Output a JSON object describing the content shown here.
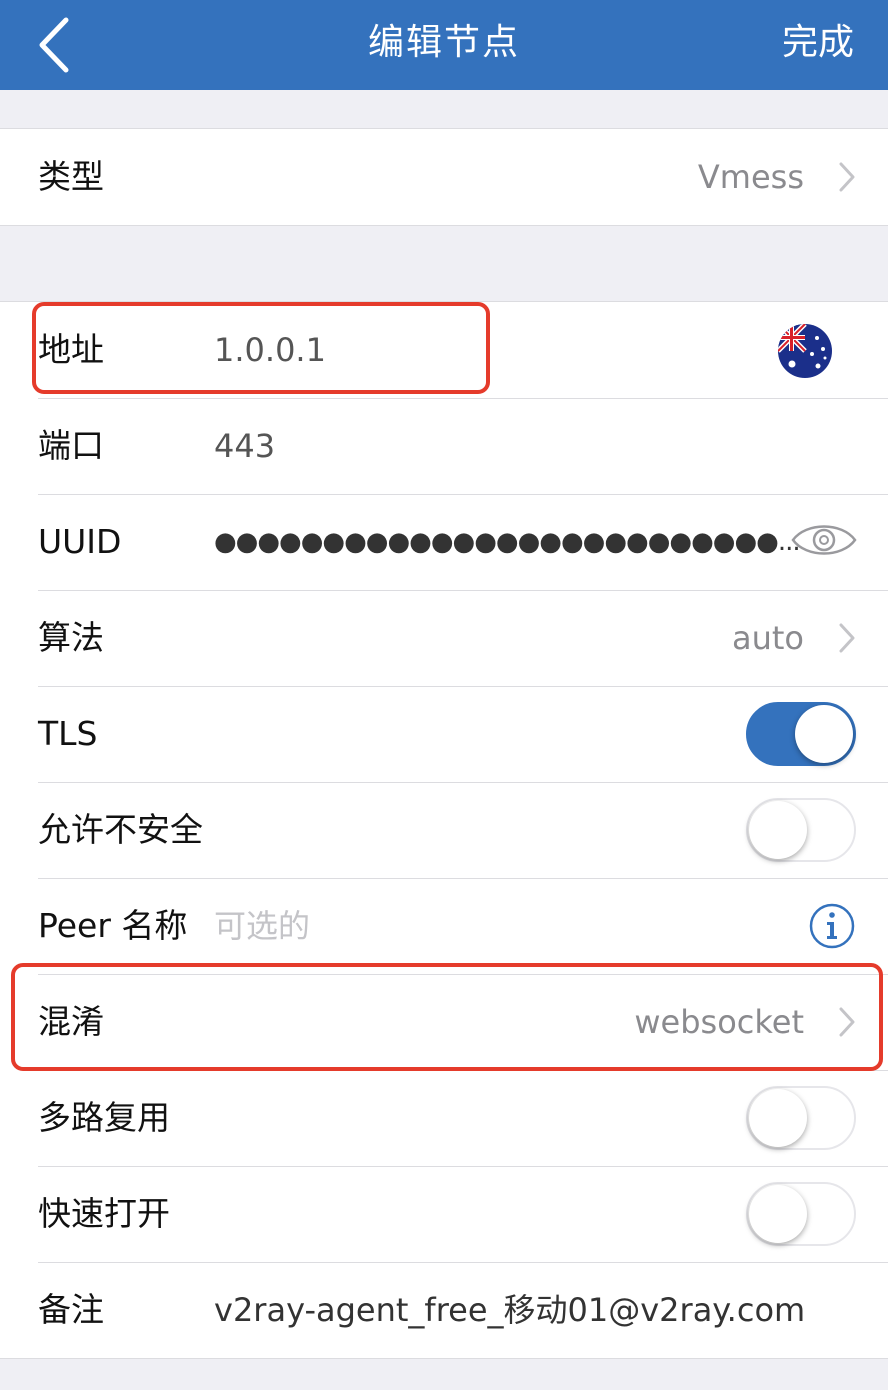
{
  "nav": {
    "title": "编辑节点",
    "done": "完成"
  },
  "type_row": {
    "label": "类型",
    "value": "Vmess"
  },
  "fields": {
    "address": {
      "label": "地址",
      "value": "1.0.0.1"
    },
    "port": {
      "label": "端口",
      "value": "443"
    },
    "uuid": {
      "label": "UUID",
      "value": "●●●●●●●●●●●●●●●●●●●●●●●●●●..."
    },
    "algorithm": {
      "label": "算法",
      "value": "auto"
    },
    "tls": {
      "label": "TLS",
      "on": true
    },
    "allow_insecure": {
      "label": "允许不安全",
      "on": false
    },
    "peer_name": {
      "label": "Peer 名称",
      "placeholder": "可选的"
    },
    "obfuscation": {
      "label": "混淆",
      "value": "websocket"
    },
    "multiplex": {
      "label": "多路复用",
      "on": false
    },
    "fast_open": {
      "label": "快速打开",
      "on": false
    },
    "remark": {
      "label": "备注",
      "value": "v2ray-agent_free_移动01@v2ray.com"
    }
  },
  "colors": {
    "accent": "#3472bd",
    "highlight": "#e53b2b"
  },
  "icons": {
    "back": "chevron-left-icon",
    "chevron": "chevron-right-icon",
    "flag": "australia-flag-icon",
    "eye": "eye-icon",
    "info": "info-icon"
  }
}
